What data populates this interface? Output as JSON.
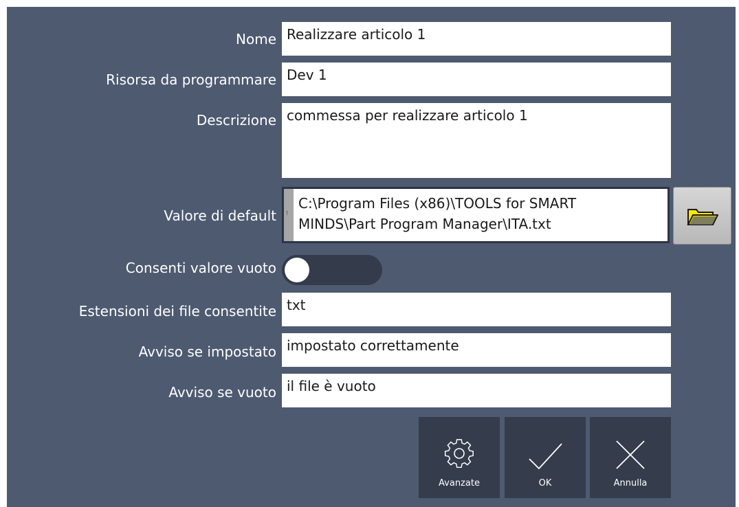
{
  "form": {
    "name": {
      "label": "Nome",
      "value": "Realizzare articolo 1"
    },
    "resource": {
      "label": "Risorsa da programmare",
      "value": "Dev 1"
    },
    "description": {
      "label": "Descrizione",
      "value": "commessa per realizzare articolo 1"
    },
    "default_value": {
      "label": "Valore di default",
      "path_line1": "C:\\Program Files (x86)\\TOOLS for SMART",
      "path_line2": "MINDS\\Part Program Manager\\ITA.txt"
    },
    "allow_empty": {
      "label": "Consenti valore vuoto",
      "state": "off"
    },
    "extensions": {
      "label": "Estensioni dei file consentite",
      "value": "txt"
    },
    "warn_if_set": {
      "label": "Avviso se impostato",
      "value": "impostato correttamente"
    },
    "warn_if_empty": {
      "label": "Avviso se vuoto",
      "value": "il file è vuoto"
    }
  },
  "buttons": {
    "advanced": {
      "label": "Avanzate",
      "icon": "gear-icon"
    },
    "ok": {
      "label": "OK",
      "icon": "check-icon"
    },
    "cancel": {
      "label": "Annulla",
      "icon": "close-icon"
    },
    "browse": {
      "icon": "folder-open-icon"
    }
  },
  "colors": {
    "panel_bg": "#4e5a70",
    "button_bg": "#353c4b",
    "folder_yellow": "#ffe600"
  }
}
